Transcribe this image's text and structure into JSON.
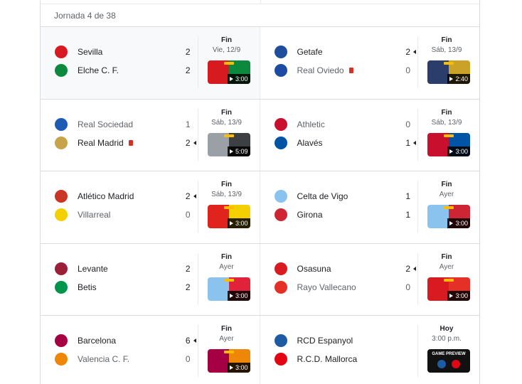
{
  "round_label": "Jornada 4 de 38",
  "rows": [
    {
      "left": {
        "home": {
          "name": "Sevilla",
          "score": "2",
          "crest": "sevilla-crest",
          "crest_color": "#d71920"
        },
        "away": {
          "name": "Elche C. F.",
          "score": "2",
          "crest": "elche-crest",
          "crest_color": "#0b8a3e"
        },
        "status": "Fin",
        "date": "Vie, 12/9",
        "duration": "3:00",
        "thumb_colors": [
          "#d71920",
          "#0b8a3e"
        ]
      },
      "right": {
        "home": {
          "name": "Getafe",
          "score": "2",
          "crest": "getafe-crest",
          "crest_color": "#1f4e9c"
        },
        "away": {
          "name": "Real Oviedo",
          "score": "0",
          "crest": "oviedo-crest",
          "crest_color": "#1d4aa3"
        },
        "status": "Fin",
        "date": "Sáb, 13/9",
        "duration": "2:40",
        "thumb_colors": [
          "#2a3d6b",
          "#c9a227"
        ]
      }
    },
    {
      "left": {
        "home": {
          "name": "Real Sociedad",
          "score": "1",
          "crest": "real-sociedad-crest",
          "crest_color": "#1e5cb3"
        },
        "away": {
          "name": "Real Madrid",
          "score": "2",
          "crest": "real-madrid-crest",
          "crest_color": "#c8a34a"
        },
        "status": "Fin",
        "date": "Sáb, 13/9",
        "duration": "5:09",
        "thumb_colors": [
          "#9aa0a6",
          "#3c4043"
        ]
      },
      "right": {
        "home": {
          "name": "Athletic",
          "score": "0",
          "crest": "athletic-crest",
          "crest_color": "#c8102e"
        },
        "away": {
          "name": "Alavés",
          "score": "1",
          "crest": "alaves-crest",
          "crest_color": "#0054a6"
        },
        "status": "Fin",
        "date": "Sáb, 13/9",
        "duration": "3:00",
        "thumb_colors": [
          "#c8102e",
          "#0054a6"
        ]
      }
    },
    {
      "left": {
        "home": {
          "name": "Atlético Madrid",
          "score": "2",
          "crest": "atletico-crest",
          "crest_color": "#cb3524"
        },
        "away": {
          "name": "Villarreal",
          "score": "0",
          "crest": "villarreal-crest",
          "crest_color": "#f5d000"
        },
        "status": "Fin",
        "date": "Sáb, 13/9",
        "duration": "3:00",
        "thumb_colors": [
          "#e0231c",
          "#f5d000"
        ]
      },
      "right": {
        "home": {
          "name": "Celta de Vigo",
          "score": "1",
          "crest": "celta-crest",
          "crest_color": "#8ac3ee"
        },
        "away": {
          "name": "Girona",
          "score": "1",
          "crest": "girona-crest",
          "crest_color": "#cd2534"
        },
        "status": "Fin",
        "date": "Ayer",
        "duration": "3:00",
        "thumb_colors": [
          "#8ac3ee",
          "#cd2534"
        ]
      }
    },
    {
      "left": {
        "home": {
          "name": "Levante",
          "score": "2",
          "crest": "levante-crest",
          "crest_color": "#9c1f3a"
        },
        "away": {
          "name": "Betis",
          "score": "2",
          "crest": "betis-crest",
          "crest_color": "#00954c"
        },
        "status": "Fin",
        "date": "Ayer",
        "duration": "3:00",
        "thumb_colors": [
          "#8ac3ee",
          "#e0233a"
        ]
      },
      "right": {
        "home": {
          "name": "Osasuna",
          "score": "2",
          "crest": "osasuna-crest",
          "crest_color": "#d91a21"
        },
        "away": {
          "name": "Rayo Vallecano",
          "score": "0",
          "crest": "rayo-crest",
          "crest_color": "#e53027"
        },
        "status": "Fin",
        "date": "Ayer",
        "duration": "3:00",
        "thumb_colors": [
          "#d91a21",
          "#e53027"
        ]
      }
    },
    {
      "left": {
        "home": {
          "name": "Barcelona",
          "score": "6",
          "crest": "barcelona-crest",
          "crest_color": "#a50044"
        },
        "away": {
          "name": "Valencia C. F.",
          "score": "0",
          "crest": "valencia-crest",
          "crest_color": "#ee8707"
        },
        "status": "Fin",
        "date": "Ayer",
        "duration": "3:00",
        "thumb_colors": [
          "#a50044",
          "#ee8707"
        ]
      },
      "right": {
        "home": {
          "name": "RCD Espanyol",
          "score": "",
          "crest": "espanyol-crest",
          "crest_color": "#1d5ba4"
        },
        "away": {
          "name": "R.C.D. Mallorca",
          "score": "",
          "crest": "mallorca-crest",
          "crest_color": "#e20613"
        },
        "status": "Hoy",
        "date": "3:00 p.m.",
        "preview": "GAME PREVIEW",
        "thumb_colors": [
          "#111111",
          "#111111"
        ]
      }
    }
  ]
}
